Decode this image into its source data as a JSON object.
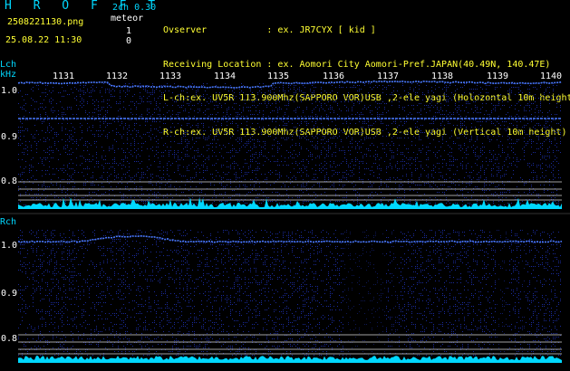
{
  "header": {
    "logo": "H R O F F T",
    "filename": "2508221130.png",
    "datetime": "25.08.22 11:30",
    "channel_setting": "2ch 0.30",
    "meteor_label": "meteor",
    "lch_count": "1",
    "rch_count": "0",
    "info_lines": [
      "Ovserver           : ex. JR7CYX [ kid ]",
      "Receiving Location : ex. Aomori City Aomori-Pref.JAPAN(40.49N, 140.47E)",
      "L-ch:ex. UV5R 113.900Mhz(SAPPORO VOR)USB ,2-ele yagi (Holozontal 10m height)",
      "R-ch:ex. UV5R 113.900Mhz(SAPPORO VOR)USB ,2-ele yagi (Vertical 10m height)"
    ]
  },
  "lch_panel": {
    "label": "Lch",
    "unit": "kHz",
    "time_ticks": [
      "1131",
      "1132",
      "1133",
      "1134",
      "1135",
      "1136",
      "1137",
      "1138",
      "1139",
      "1140"
    ],
    "freq_ticks": [
      "1.0",
      "0.9",
      "0.8"
    ]
  },
  "rch_panel": {
    "label": "Rch",
    "freq_ticks": [
      "1.0",
      "0.9",
      "0.8"
    ]
  },
  "colors": {
    "background": "#000000",
    "noise": "#1a2a9a",
    "signal": "#4a7aff",
    "level_bar": "#00d8ff",
    "grid_line": "#d8d8d8",
    "header_cyan": "#00d8ff",
    "header_yellow": "#ffff33"
  }
}
